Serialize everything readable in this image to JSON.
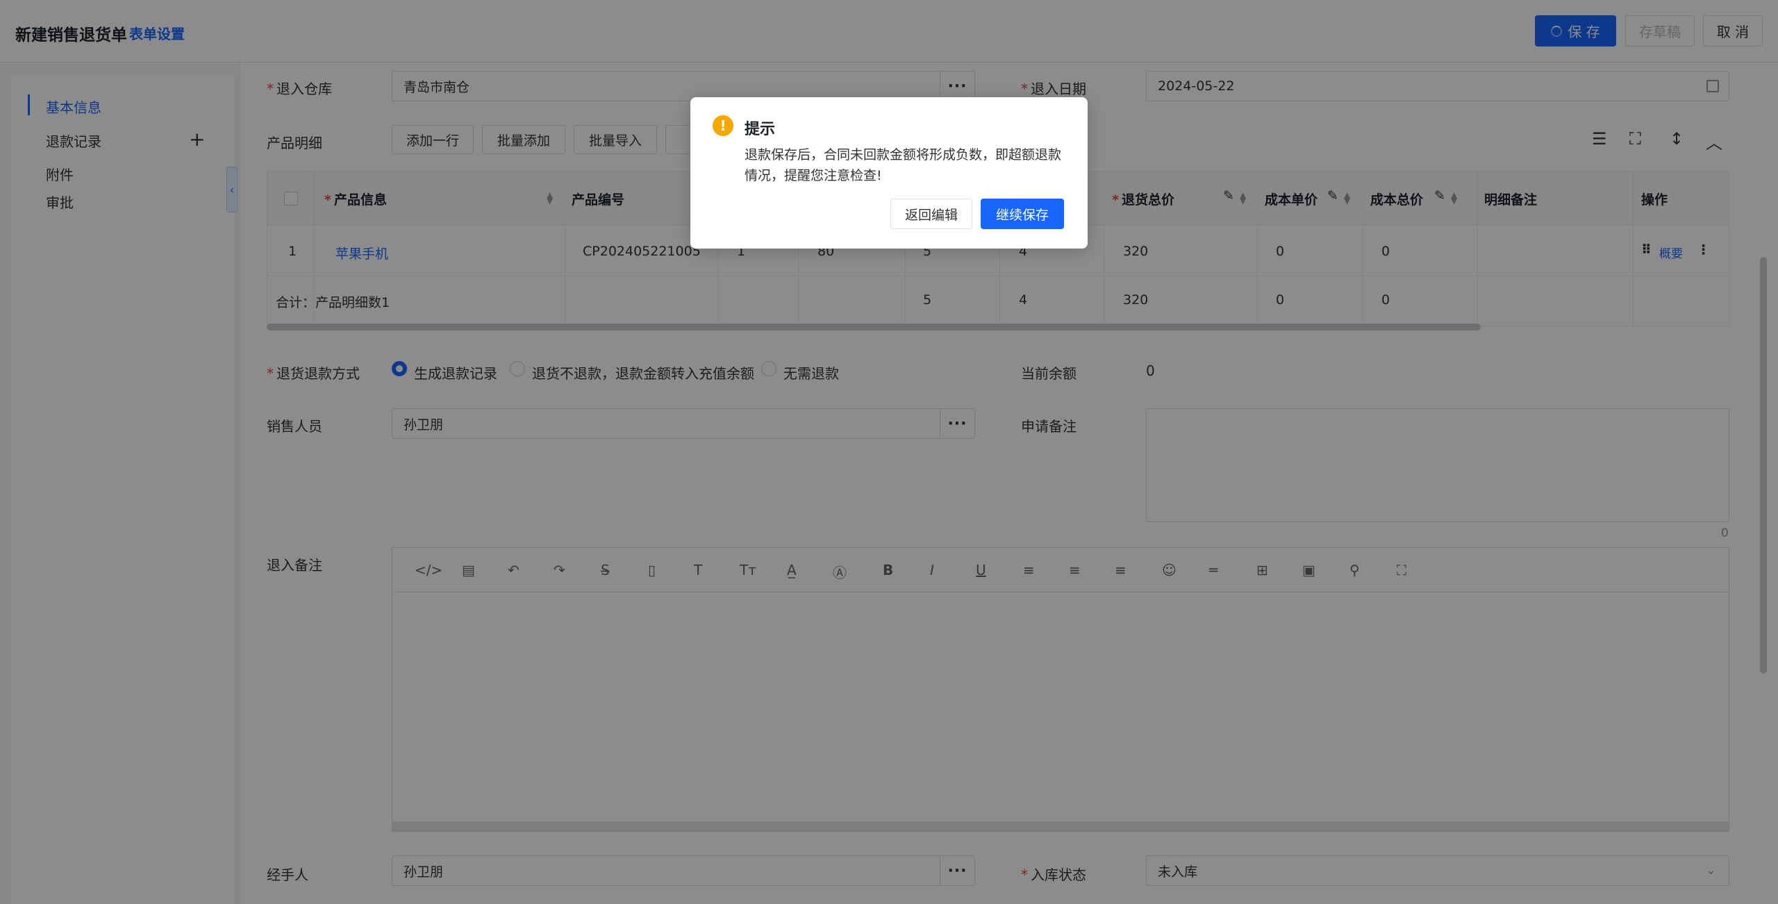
{
  "header": {
    "title": "新建销售退货单",
    "form_settings": "表单设置",
    "save_label": "保 存",
    "draft_label": "存草稿",
    "cancel_label": "取 消"
  },
  "sidebar": {
    "items": [
      {
        "label": "基本信息",
        "active": true
      },
      {
        "label": "退款记录",
        "active": false
      },
      {
        "label": "附件",
        "active": false
      },
      {
        "label": "审批",
        "active": false
      }
    ],
    "add_icon": "plus-icon",
    "collapse_icon": "chevron-left-icon"
  },
  "form": {
    "warehouse_label": "退入仓库",
    "warehouse_value": "青岛市南仓",
    "date_label": "退入日期",
    "date_value": "2024-05-22",
    "product_detail_label": "产品明细",
    "add_row": "添加一行",
    "batch_add": "批量添加",
    "batch_import": "批量导入",
    "refund_method_label": "退货退款方式",
    "refund_options": [
      "生成退款记录",
      "退货不退款，退款金额转入充值余额",
      "无需退款"
    ],
    "refund_selected": 0,
    "balance_label": "当前余额",
    "balance_value": "0",
    "sales_person_label": "销售人员",
    "sales_person_value": "孙卫朋",
    "apply_note_label": "申请备注",
    "apply_note_count": "0",
    "return_note_label": "退入备注",
    "handler_label": "经手人",
    "handler_value": "孙卫朋",
    "stock_status_label": "入库状态",
    "stock_status_value": "未入库"
  },
  "table": {
    "headers": {
      "product_info": "产品信息",
      "product_code": "产品编号",
      "return_total": "退货总价",
      "cost_unit": "成本单价",
      "cost_total": "成本总价",
      "detail_note": "明细备注",
      "operation": "操作"
    },
    "row": {
      "index": "1",
      "product": "苹果手机",
      "code": "CP202405221005",
      "unit": "1",
      "price": "80",
      "qty": "5",
      "ret_qty": "4",
      "return_total": "320",
      "cost_unit": "0",
      "cost_total": "0",
      "op_link": "概要"
    },
    "summary": {
      "label": "合计：产品明细数1",
      "qty": "5",
      "ret_qty": "4",
      "return_total": "320",
      "cost_unit": "0",
      "cost_total": "0"
    }
  },
  "dialog": {
    "title": "提示",
    "message": "退款保存后，合同未回款金额将形成负数，即超额退款情况，提醒您注意检查!",
    "back_label": "返回编辑",
    "continue_label": "继续保存",
    "icon": "warning-icon"
  },
  "colors": {
    "primary": "#1966ff",
    "warning": "#f7a600",
    "required": "#f53f3f"
  }
}
